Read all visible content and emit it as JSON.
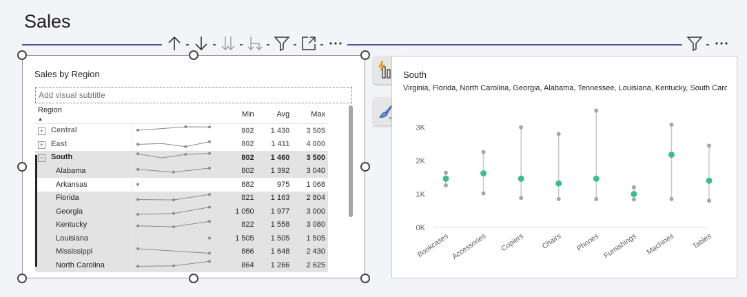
{
  "page": {
    "title": "Sales"
  },
  "toolbar_left": [
    {
      "icon": "arrow-up-icon",
      "enabled": true
    },
    {
      "icon": "arrow-down-icon",
      "enabled": true
    },
    {
      "icon": "double-arrow-down-icon",
      "enabled": false
    },
    {
      "icon": "expand-hierarchy-icon",
      "enabled": false
    },
    {
      "icon": "filter-icon",
      "enabled": true
    },
    {
      "icon": "focus-mode-icon",
      "enabled": true
    },
    {
      "icon": "more-options-icon",
      "enabled": true
    }
  ],
  "toolbar_right": [
    {
      "icon": "filter-icon"
    },
    {
      "icon": "more-options-icon"
    }
  ],
  "left_visual": {
    "title": "Sales by Region",
    "subtitle_placeholder": "Add visual subtitle",
    "columns": [
      "Region",
      "",
      "Min",
      "Avg",
      "Max"
    ],
    "rows": [
      {
        "name": "Central",
        "level": 1,
        "expander": "+",
        "min": "802",
        "avg": "1 430",
        "max": "3 505",
        "spark": [
          0.55,
          0.72,
          0.92,
          0.9
        ]
      },
      {
        "name": "East",
        "level": 1,
        "expander": "+",
        "min": "802",
        "avg": "1 411",
        "max": "4 000",
        "spark": [
          0.5,
          0.6,
          0.25,
          0.8
        ]
      },
      {
        "name": "South",
        "level": 1,
        "expander": "−",
        "min": "802",
        "avg": "1 460",
        "max": "3 500",
        "selected": true,
        "spark": [
          0.9,
          0.45,
          0.85,
          0.95
        ]
      },
      {
        "name": "Alabama",
        "level": 2,
        "min": "802",
        "avg": "1 392",
        "max": "3 040",
        "selected": true,
        "spark": [
          0.7,
          0.4,
          0.85
        ]
      },
      {
        "name": "Arkansas",
        "level": 2,
        "min": "882",
        "avg": "975",
        "max": "1 068",
        "selected": false,
        "spark": [
          0.5
        ]
      },
      {
        "name": "Florida",
        "level": 2,
        "min": "821",
        "avg": "1 163",
        "max": "2 804",
        "selected": true,
        "spark": [
          0.35,
          0.3,
          0.9
        ]
      },
      {
        "name": "Georgia",
        "level": 2,
        "min": "1 050",
        "avg": "1 977",
        "max": "3 000",
        "selected": true,
        "spark": [
          0.15,
          0.25,
          0.95
        ]
      },
      {
        "name": "Kentucky",
        "level": 2,
        "min": "822",
        "avg": "1 558",
        "max": "3 080",
        "selected": true,
        "spark": [
          0.4,
          0.3,
          0.9
        ]
      },
      {
        "name": "Louisiana",
        "level": 2,
        "min": "1 505",
        "avg": "1 505",
        "max": "1 505",
        "selected": true,
        "spark": [
          0.5
        ]
      },
      {
        "name": "Mississippi",
        "level": 2,
        "min": "866",
        "avg": "1 648",
        "max": "2 430",
        "selected": true,
        "spark": [
          0.85,
          0.35
        ]
      },
      {
        "name": "North Carolina",
        "level": 2,
        "min": "864",
        "avg": "1 266",
        "max": "2 625",
        "selected": true,
        "spark": [
          0.35,
          0.4,
          0.9
        ]
      }
    ]
  },
  "side_buttons": [
    {
      "icon": "quick-insights-chart-icon"
    },
    {
      "icon": "format-visual-brush-icon"
    }
  ],
  "right_visual": {
    "title": "South",
    "subtitle": "Virginia, Florida, North Carolina, Georgia, Alabama, Tennessee, Louisiana, Kentucky, South Carolin..."
  },
  "chart_data": {
    "type": "dumbbell",
    "title": "South",
    "categories": [
      "Bookcases",
      "Accessories",
      "Copiers",
      "Chairs",
      "Phones",
      "Furnishings",
      "Machines",
      "Tables"
    ],
    "series": [
      {
        "name": "Min",
        "values": [
          1260,
          1020,
          880,
          850,
          850,
          840,
          850,
          800
        ]
      },
      {
        "name": "Avg",
        "values": [
          1460,
          1620,
          1460,
          1320,
          1460,
          1000,
          2180,
          1400
        ]
      },
      {
        "name": "Max",
        "values": [
          1640,
          2260,
          3000,
          2800,
          3500,
          1200,
          3080,
          2450
        ]
      }
    ],
    "yticks": [
      "0K",
      "1K",
      "2K",
      "3K"
    ],
    "ylim": [
      0,
      3800
    ],
    "colors": {
      "avg": "#3cbf84",
      "minmax": "#a6a6a6",
      "line": "#c8c8c8"
    }
  }
}
